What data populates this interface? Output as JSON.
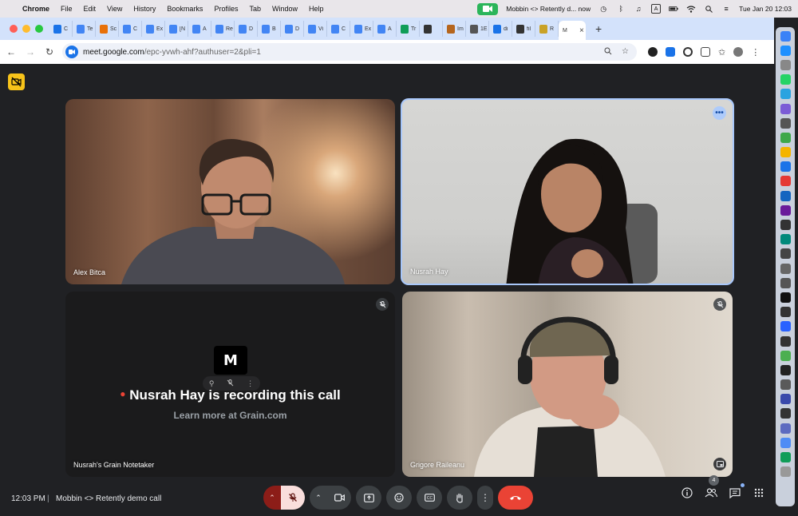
{
  "menubar": {
    "app": "Chrome",
    "items": [
      "File",
      "Edit",
      "View",
      "History",
      "Bookmarks",
      "Profiles",
      "Tab",
      "Window",
      "Help"
    ],
    "notification": "Mobbin <> Retently d... now",
    "input_source": "A",
    "datetime": "Tue Jan 20  12:03"
  },
  "tabs": [
    {
      "title": "C",
      "color": "#1a73e8"
    },
    {
      "title": "Te",
      "color": "#4285f4"
    },
    {
      "title": "Sc",
      "color": "#e8710a"
    },
    {
      "title": "C",
      "color": "#4285f4"
    },
    {
      "title": "Ex",
      "color": "#4285f4"
    },
    {
      "title": "[N",
      "color": "#4285f4"
    },
    {
      "title": "A",
      "color": "#4285f4"
    },
    {
      "title": "Re",
      "color": "#4285f4"
    },
    {
      "title": "D",
      "color": "#4285f4"
    },
    {
      "title": "B",
      "color": "#4285f4"
    },
    {
      "title": "D",
      "color": "#4285f4"
    },
    {
      "title": "Vi",
      "color": "#4285f4"
    },
    {
      "title": "C",
      "color": "#4285f4"
    },
    {
      "title": "Ex",
      "color": "#4285f4"
    },
    {
      "title": "A",
      "color": "#4285f4"
    },
    {
      "title": "Tr",
      "color": "#0f9d58"
    },
    {
      "title": "",
      "color": "#333"
    },
    {
      "title": "Îm",
      "color": "#b5651d"
    },
    {
      "title": "1E",
      "color": "#555"
    },
    {
      "title": "di",
      "color": "#1a73e8"
    },
    {
      "title": "fil",
      "color": "#333"
    },
    {
      "title": "R",
      "color": "#c9a227"
    }
  ],
  "active_tab": {
    "title": "M",
    "close": "×"
  },
  "new_tab": "+",
  "address": {
    "host": "meet.google.com",
    "path": "/epc-yvwh-ahf?authuser=2&pli=1"
  },
  "participants": [
    {
      "name": "Alex Bitca"
    },
    {
      "name": "Nusrah Hay"
    },
    {
      "name": "Nusrah's Grain Notetaker"
    },
    {
      "name": "Grigore Raileanu"
    }
  ],
  "grain": {
    "logo": "M",
    "recording_text": "Nusrah Hay is recording this call",
    "learn_more": "Learn more at Grain.com"
  },
  "bottom": {
    "time": "12:03 PM",
    "separator": "|",
    "meeting_title": "Mobbin <> Retently demo call",
    "people_count": "4"
  },
  "colors": {
    "end_call": "#ea4335",
    "mic_off_bg": "#f9dedc",
    "active_border": "#a8c7fa",
    "rec_indicator": "#f7c31a"
  }
}
